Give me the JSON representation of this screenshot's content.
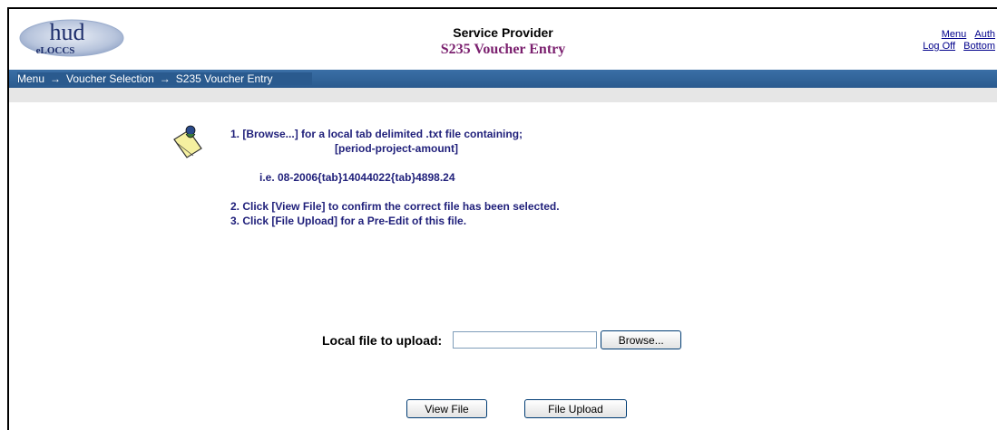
{
  "header": {
    "logo_text_main": "hud",
    "logo_text_sub": "eLOCCS",
    "app_title": "Service Provider",
    "page_title": "S235 Voucher Entry",
    "links": {
      "menu": "Menu",
      "auth": "Auth",
      "logoff": "Log Off",
      "bottom": "Bottom"
    }
  },
  "breadcrumb": {
    "items": [
      "Menu",
      "Voucher Selection",
      "S235 Voucher Entry"
    ],
    "separator": "→"
  },
  "instructions": {
    "step1_line1": "1.  [Browse...] for a local tab delimited .txt file containing;",
    "step1_line2": "[period-project-amount]",
    "example": "i.e.   08-2006{tab}14044022{tab}4898.24",
    "step2": "2.  Click [View File] to confirm the correct file has been selected.",
    "step3": "3.  Click [File Upload] for a Pre-Edit of this file."
  },
  "upload": {
    "label": "Local file to upload:",
    "file_value": "",
    "browse_label": "Browse..."
  },
  "actions": {
    "view_file_label": "View File",
    "file_upload_label": "File Upload"
  },
  "icons": {
    "note": "note-pad-icon",
    "arrow": "arrow-right-icon"
  },
  "colors": {
    "navbar": "#2a5a8e",
    "title_accent": "#7a1f6e",
    "instruction_text": "#1f1f7a",
    "link": "#00008b"
  }
}
